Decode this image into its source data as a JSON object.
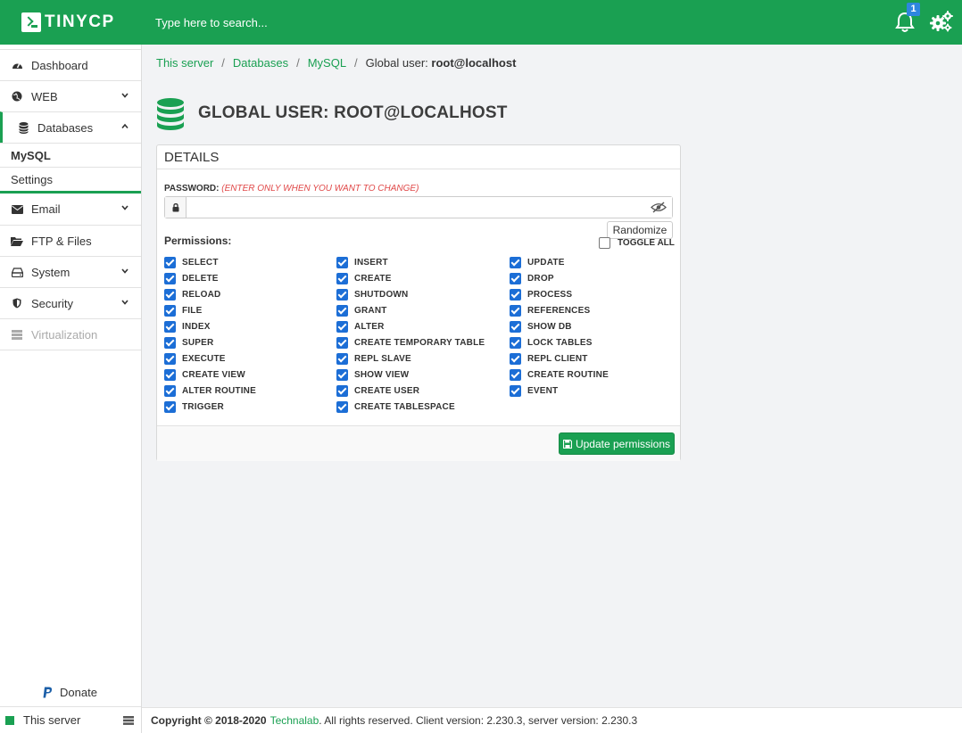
{
  "brand": {
    "name": "TINYCP"
  },
  "search": {
    "placeholder": "Type here to search..."
  },
  "notifications": {
    "count": "1"
  },
  "sidebar": {
    "items": [
      {
        "label": "Dashboard",
        "icon": "dashboard-icon"
      },
      {
        "label": "WEB",
        "icon": "globe-icon"
      },
      {
        "label": "Databases",
        "icon": "database-icon"
      },
      {
        "label": "Email",
        "icon": "envelope-icon"
      },
      {
        "label": "FTP & Files",
        "icon": "folder-icon"
      },
      {
        "label": "System",
        "icon": "hdd-icon"
      },
      {
        "label": "Security",
        "icon": "shield-icon"
      },
      {
        "label": "Virtualization",
        "icon": "server-icon"
      }
    ],
    "sub_items": [
      {
        "label": "MySQL"
      },
      {
        "label": "Settings"
      }
    ],
    "donate": "Donate",
    "server": "This server"
  },
  "breadcrumb": {
    "items": [
      "This server",
      "Databases",
      "MySQL"
    ],
    "current_prefix": "Global user:",
    "current_name": "root@localhost"
  },
  "page": {
    "title": "GLOBAL USER: ROOT@LOCALHOST"
  },
  "details": {
    "header": "DETAILS",
    "password_label": "PASSWORD:",
    "password_hint": "(ENTER ONLY WHEN YOU WANT TO CHANGE)",
    "password_value": "",
    "randomize": "Randomize",
    "permissions_label": "Permissions:",
    "toggle_all": "TOGGLE ALL",
    "permissions": [
      [
        "SELECT",
        "DELETE",
        "RELOAD",
        "FILE",
        "INDEX",
        "SUPER",
        "EXECUTE",
        "CREATE VIEW",
        "ALTER ROUTINE",
        "TRIGGER"
      ],
      [
        "INSERT",
        "CREATE",
        "SHUTDOWN",
        "GRANT",
        "ALTER",
        "CREATE TEMPORARY TABLE",
        "REPL SLAVE",
        "SHOW VIEW",
        "CREATE USER",
        "CREATE TABLESPACE"
      ],
      [
        "UPDATE",
        "DROP",
        "PROCESS",
        "REFERENCES",
        "SHOW DB",
        "LOCK TABLES",
        "REPL CLIENT",
        "CREATE ROUTINE",
        "EVENT"
      ]
    ],
    "update_button": "Update permissions"
  },
  "footer": {
    "copyright": "Copyright © 2018-2020",
    "company": "Technalab",
    "rest": ". All rights reserved. Client version: 2.230.3, server version: 2.230.3"
  },
  "colors": {
    "accent": "#1aa052",
    "checkbox": "#1c6ed6",
    "hint": "#e04848"
  }
}
